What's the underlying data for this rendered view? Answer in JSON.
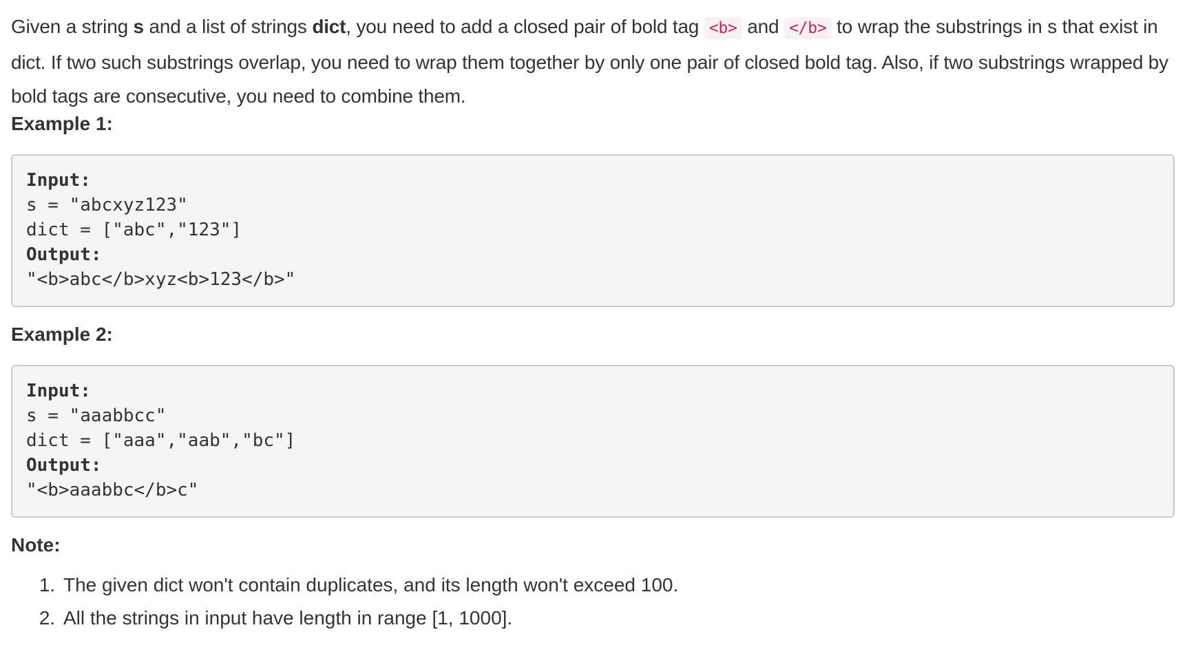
{
  "intro": {
    "p1": "Given a string ",
    "s_bold": "s",
    "p2": " and a list of strings ",
    "dict_bold": "dict",
    "p3": ", you need to add a closed pair of bold tag ",
    "tag_open": "<b>",
    "p4": " and ",
    "tag_close": "</b>",
    "p5": " to wrap the substrings in s that exist in dict. If two such substrings overlap, you need to wrap them together by only one pair of closed bold tag. Also, if two substrings wrapped by bold tags are consecutive, you need to combine them."
  },
  "example1": {
    "heading": "Example 1:",
    "input_label": "Input:",
    "line_s": "s = \"abcxyz123\"",
    "line_dict": "dict = [\"abc\",\"123\"]",
    "output_label": "Output:",
    "output_value": "\"<b>abc</b>xyz<b>123</b>\""
  },
  "example2": {
    "heading": "Example 2:",
    "input_label": "Input:",
    "line_s": "s = \"aaabbcc\"",
    "line_dict": "dict = [\"aaa\",\"aab\",\"bc\"]",
    "output_label": "Output:",
    "output_value": "\"<b>aaabbc</b>c\""
  },
  "note": {
    "heading": "Note:",
    "items": [
      "The given dict won't contain duplicates, and its length won't exceed 100.",
      "All the strings in input have length in range [1, 1000]."
    ]
  }
}
